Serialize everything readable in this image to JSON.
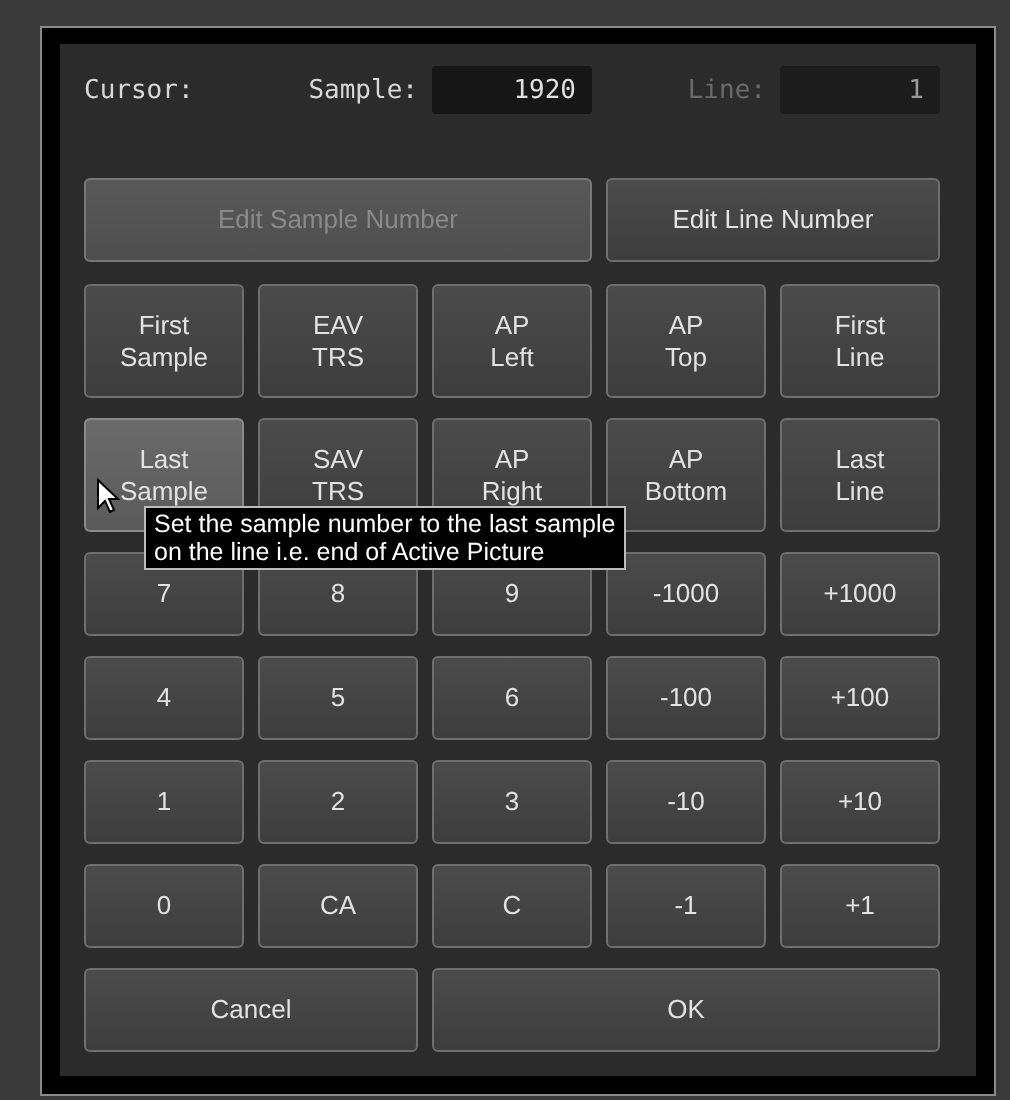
{
  "cursor_bar": {
    "label": "Cursor:",
    "fields": [
      {
        "label": "Sample:",
        "value": "1920",
        "active": true
      },
      {
        "label": "Line:",
        "value": "1",
        "active": false
      }
    ]
  },
  "mode_buttons": [
    {
      "label": "Edit Sample Number",
      "disabled": true
    },
    {
      "label": "Edit Line Number",
      "disabled": false
    }
  ],
  "keypad": [
    [
      {
        "label": "First\nSample",
        "hovered": false
      },
      {
        "label": "EAV\nTRS",
        "hovered": false
      },
      {
        "label": "AP\nLeft",
        "hovered": false
      },
      {
        "label": "AP\nTop",
        "hovered": false
      },
      {
        "label": "First\nLine",
        "hovered": false
      }
    ],
    [
      {
        "label": "Last\nSample",
        "hovered": true
      },
      {
        "label": "SAV\nTRS",
        "hovered": false
      },
      {
        "label": "AP\nRight",
        "hovered": false
      },
      {
        "label": "AP\nBottom",
        "hovered": false
      },
      {
        "label": "Last\nLine",
        "hovered": false
      }
    ],
    [
      {
        "label": "7",
        "hovered": false
      },
      {
        "label": "8",
        "hovered": false
      },
      {
        "label": "9",
        "hovered": false
      },
      {
        "label": "-1000",
        "hovered": false
      },
      {
        "label": "+1000",
        "hovered": false
      }
    ],
    [
      {
        "label": "4",
        "hovered": false
      },
      {
        "label": "5",
        "hovered": false
      },
      {
        "label": "6",
        "hovered": false
      },
      {
        "label": "-100",
        "hovered": false
      },
      {
        "label": "+100",
        "hovered": false
      }
    ],
    [
      {
        "label": "1",
        "hovered": false
      },
      {
        "label": "2",
        "hovered": false
      },
      {
        "label": "3",
        "hovered": false
      },
      {
        "label": "-10",
        "hovered": false
      },
      {
        "label": "+10",
        "hovered": false
      }
    ],
    [
      {
        "label": "0",
        "hovered": false
      },
      {
        "label": "CA",
        "hovered": false
      },
      {
        "label": "C",
        "hovered": false
      },
      {
        "label": "-1",
        "hovered": false
      },
      {
        "label": "+1",
        "hovered": false
      }
    ]
  ],
  "tooltip": {
    "text": "Set the sample number to the last sample\non the line i.e. end of Active Picture"
  },
  "actions": [
    "Cancel",
    "OK"
  ]
}
